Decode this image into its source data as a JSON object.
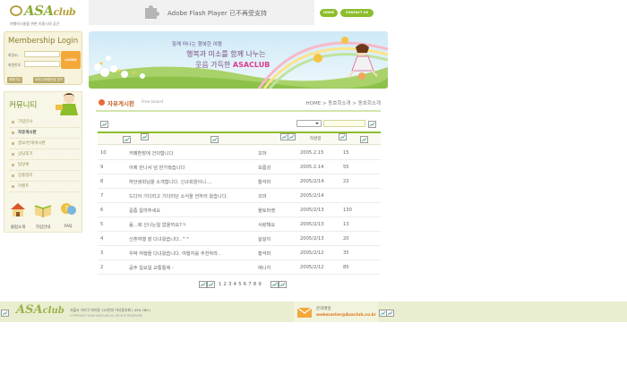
{
  "logo": {
    "name": "ASA",
    "suffix": "club",
    "tagline": "여행미시들을 위한 미중시의 공간"
  },
  "flash_notice": "Adobe Flash Player 已不再受支持",
  "top_links": {
    "home": "HOME",
    "contact": "CONTACT US"
  },
  "login": {
    "title": "Membership Login",
    "id_label": "회원ID",
    "pw_label": "회원번호",
    "button": "LOGIN",
    "join": "회원가입",
    "find": "아이디/비밀번호 찾기"
  },
  "community": {
    "title": "커뮤니티",
    "items": [
      "가입인사",
      "자유게시판",
      "정보/번개게시판",
      "상담후기",
      "탐방록",
      "앙풀정리",
      "이벤트"
    ],
    "quick_links": [
      "클럽소개",
      "가입안내",
      "FAQ"
    ]
  },
  "banner": {
    "line1": "함께 떠나는 행복한 여행",
    "line2": "행복과 미소를 함께 나누는",
    "line3": "웃음 가득한",
    "brand": "ASACLUB"
  },
  "board": {
    "title": "자유게시판",
    "subtitle": "Free board",
    "breadcrumb": "HOME > 동호회소개 > 동호회소개",
    "header_date": "작성일",
    "rows": [
      {
        "no": "10",
        "title": "카페환장에 건의합니다",
        "author": "꼬마",
        "date": "2005.2.15",
        "hits": "15"
      },
      {
        "no": "9",
        "title": "어제 만나서 넘 반가웠습니다",
        "author": "보름성",
        "date": "2005.2.14",
        "hits": "55"
      },
      {
        "no": "8",
        "title": "하안생회님을 소개합니다. 신규회원이니....",
        "author": "황석마",
        "date": "2005/2/14",
        "hits": "22"
      },
      {
        "no": "7",
        "title": "드디어 기다리고 기다리던 소식을 전하러 왔습니다.",
        "author": "꼬마",
        "date": "2005/2/14",
        "hits": ""
      },
      {
        "no": "6",
        "title": "길좀 알려주세요",
        "author": "올토마켓",
        "date": "2005/2/13",
        "hits": "130"
      },
      {
        "no": "5",
        "title": "음...뭐 신나는일 없을까요?ㅋ",
        "author": "사랑해요",
        "date": "2005/2/13",
        "hits": "13"
      },
      {
        "no": "4",
        "title": "신혼여행 잘 다녀왔습니다..^^",
        "author": "살살이",
        "date": "2005/2/13",
        "hits": "20"
      },
      {
        "no": "3",
        "title": "우박 여행을 다녀왔습니다. 여행지를 추천하라..",
        "author": "황석마",
        "date": "2005/2/12",
        "hits": "35"
      },
      {
        "no": "2",
        "title": "공주 일요일 교통통제 -",
        "author": "애니지",
        "date": "2005/2/12",
        "hits": "85"
      }
    ],
    "pages": "1 2 3 4 5 6 7 8 9"
  },
  "footer": {
    "logo_name": "ASA",
    "logo_suffix": "club",
    "address": "서울시 가리구 마자동 123번지 아사동호회 ( 450-789 )",
    "copyright": "COPYRIGHT 2006 ASACLUB ALL RIGHTS RESERVED",
    "mail_label": "문의메일",
    "mail": "webmaster@Asaclub.co.kr"
  },
  "colors": {
    "accent_green": "#8cbd2b",
    "accent_orange": "#e96a3a",
    "brand_pink": "#e03a90"
  }
}
